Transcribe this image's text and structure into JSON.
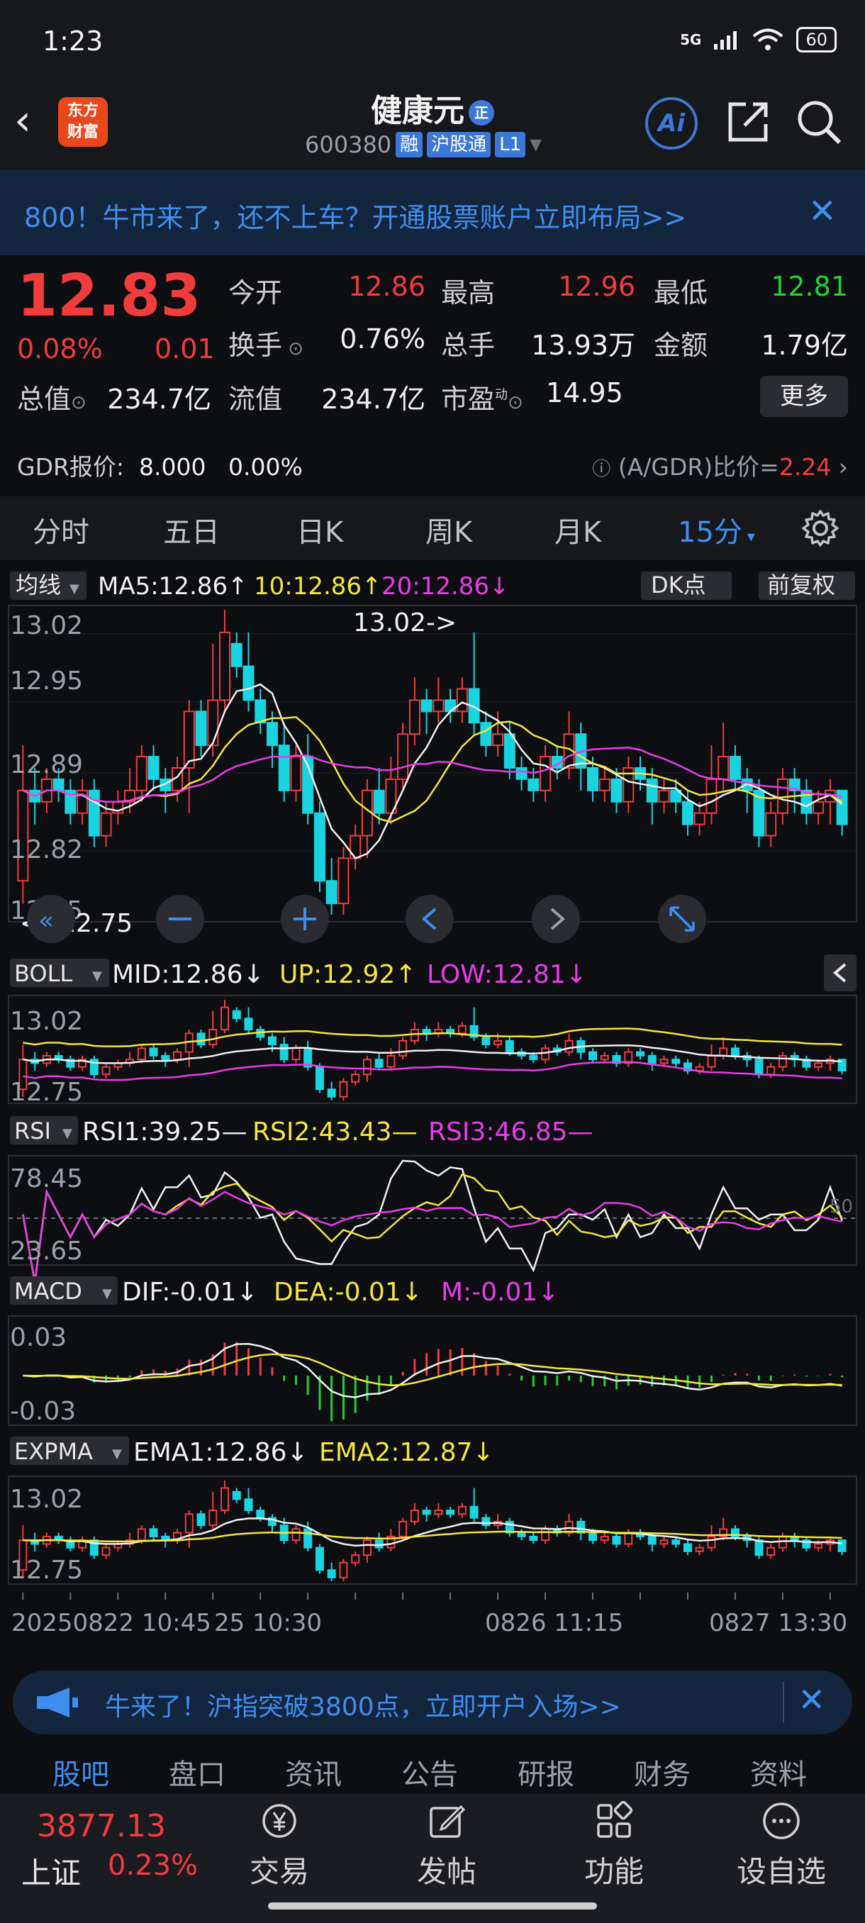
{
  "status_bar": {
    "time": "1:23",
    "network": "5G",
    "battery": "60"
  },
  "header": {
    "stock_name": "健康元",
    "badge": "正",
    "stock_code": "600380",
    "tags": [
      "融",
      "沪股通",
      "L1"
    ],
    "broker_logo": "东方\n财富",
    "ai_label": "Ai"
  },
  "top_banner": {
    "text": "800！牛市来了，还不上车？开通股票账户立即布局>>"
  },
  "quote": {
    "price": "12.83",
    "change_pct": "0.08%",
    "change_val": "0.01",
    "open_label": "今开",
    "open": "12.86",
    "high_label": "最高",
    "high": "12.96",
    "low_label": "最低",
    "low": "12.81",
    "turnover_label": "换手",
    "turnover": "0.76%",
    "volume_label": "总手",
    "volume": "13.93万",
    "amount_label": "金额",
    "amount": "1.79亿",
    "mktcap_label": "总值",
    "mktcap": "234.7亿",
    "float_label": "流值",
    "float": "234.7亿",
    "pe_label": "市盈",
    "pe_sup": "动",
    "pe": "14.95",
    "more_label": "更多",
    "gdr_label": "GDR报价:",
    "gdr_price": "8.000",
    "gdr_pct": "0.00%",
    "gdr_ratio_label": "(A/GDR)比价=",
    "gdr_ratio": "2.24"
  },
  "period_tabs": [
    "分时",
    "五日",
    "日K",
    "周K",
    "月K",
    "15分"
  ],
  "active_period": "15分",
  "chart_data": {
    "type": "candlestick",
    "main": {
      "indicator": "均线",
      "ma5": "MA5:12.86↑",
      "ma10": "10:12.86↑",
      "ma20": "20:12.86↓",
      "dk_label": "DK点",
      "adjust_label": "前复权",
      "ymax_label": "13.02",
      "y2_label": "12.95",
      "y3_label": "12.89",
      "y4_label": "12.82",
      "ymin_label": "12.75",
      "high_marker": "13.02->",
      "low_marker": "<--12.75",
      "ylim": [
        12.75,
        13.02
      ],
      "candles": [
        [
          12.78,
          12.86,
          12.9,
          12.76
        ],
        [
          12.86,
          12.85,
          12.88,
          12.83
        ],
        [
          12.85,
          12.87,
          12.88,
          12.84
        ],
        [
          12.87,
          12.86,
          12.88,
          12.85
        ],
        [
          12.86,
          12.84,
          12.87,
          12.83
        ],
        [
          12.84,
          12.86,
          12.87,
          12.83
        ],
        [
          12.86,
          12.82,
          12.87,
          12.81
        ],
        [
          12.82,
          12.84,
          12.85,
          12.81
        ],
        [
          12.84,
          12.85,
          12.86,
          12.83
        ],
        [
          12.85,
          12.86,
          12.88,
          12.84
        ],
        [
          12.86,
          12.89,
          12.9,
          12.85
        ],
        [
          12.89,
          12.87,
          12.9,
          12.86
        ],
        [
          12.87,
          12.86,
          12.88,
          12.84
        ],
        [
          12.86,
          12.88,
          12.89,
          12.85
        ],
        [
          12.88,
          12.93,
          12.94,
          12.84
        ],
        [
          12.93,
          12.9,
          12.94,
          12.89
        ],
        [
          12.9,
          12.94,
          12.99,
          12.89
        ],
        [
          12.94,
          13.0,
          13.02,
          12.93
        ],
        [
          12.99,
          12.97,
          13.0,
          12.96
        ],
        [
          12.97,
          12.94,
          13.0,
          12.93
        ],
        [
          12.94,
          12.92,
          12.95,
          12.91
        ],
        [
          12.92,
          12.9,
          12.93,
          12.88
        ],
        [
          12.9,
          12.86,
          12.92,
          12.85
        ],
        [
          12.86,
          12.89,
          12.9,
          12.85
        ],
        [
          12.89,
          12.84,
          12.91,
          12.83
        ],
        [
          12.84,
          12.78,
          12.85,
          12.77
        ],
        [
          12.78,
          12.76,
          12.8,
          12.75
        ],
        [
          12.76,
          12.8,
          12.81,
          12.75
        ],
        [
          12.8,
          12.82,
          12.83,
          12.79
        ],
        [
          12.82,
          12.86,
          12.87,
          12.8
        ],
        [
          12.86,
          12.84,
          12.88,
          12.83
        ],
        [
          12.84,
          12.87,
          12.89,
          12.83
        ],
        [
          12.87,
          12.91,
          12.92,
          12.86
        ],
        [
          12.91,
          12.94,
          12.96,
          12.9
        ],
        [
          12.94,
          12.93,
          12.95,
          12.91
        ],
        [
          12.93,
          12.94,
          12.96,
          12.92
        ],
        [
          12.94,
          12.93,
          12.95,
          12.92
        ],
        [
          12.93,
          12.95,
          12.96,
          12.92
        ],
        [
          12.95,
          12.92,
          13.0,
          12.91
        ],
        [
          12.92,
          12.9,
          12.93,
          12.89
        ],
        [
          12.9,
          12.91,
          12.93,
          12.89
        ],
        [
          12.91,
          12.88,
          12.92,
          12.87
        ],
        [
          12.88,
          12.87,
          12.89,
          12.86
        ],
        [
          12.87,
          12.86,
          12.88,
          12.85
        ],
        [
          12.86,
          12.89,
          12.9,
          12.85
        ],
        [
          12.89,
          12.88,
          12.9,
          12.87
        ],
        [
          12.88,
          12.91,
          12.93,
          12.87
        ],
        [
          12.91,
          12.88,
          12.92,
          12.86
        ],
        [
          12.88,
          12.86,
          12.89,
          12.85
        ],
        [
          12.86,
          12.87,
          12.88,
          12.85
        ],
        [
          12.87,
          12.85,
          12.88,
          12.84
        ],
        [
          12.85,
          12.88,
          12.89,
          12.84
        ],
        [
          12.88,
          12.87,
          12.89,
          12.86
        ],
        [
          12.87,
          12.85,
          12.88,
          12.83
        ],
        [
          12.85,
          12.86,
          12.87,
          12.84
        ],
        [
          12.86,
          12.85,
          12.87,
          12.84
        ],
        [
          12.85,
          12.83,
          12.86,
          12.82
        ],
        [
          12.83,
          12.84,
          12.85,
          12.82
        ],
        [
          12.84,
          12.87,
          12.9,
          12.83
        ],
        [
          12.87,
          12.89,
          12.92,
          12.86
        ],
        [
          12.89,
          12.87,
          12.9,
          12.86
        ],
        [
          12.87,
          12.86,
          12.88,
          12.84
        ],
        [
          12.86,
          12.82,
          12.87,
          12.81
        ],
        [
          12.82,
          12.84,
          12.85,
          12.81
        ],
        [
          12.84,
          12.87,
          12.88,
          12.83
        ],
        [
          12.87,
          12.86,
          12.88,
          12.84
        ],
        [
          12.86,
          12.84,
          12.87,
          12.83
        ],
        [
          12.84,
          12.85,
          12.86,
          12.83
        ],
        [
          12.85,
          12.86,
          12.87,
          12.83
        ],
        [
          12.86,
          12.83,
          12.86,
          12.82
        ]
      ]
    },
    "boll": {
      "label": "BOLL",
      "mid": "MID:12.86↓",
      "up": "UP:12.92↑",
      "low": "LOW:12.81↓",
      "ymax_label": "13.02",
      "ymin_label": "12.75"
    },
    "rsi": {
      "label": "RSI",
      "rsi1": "RSI1:39.25—",
      "rsi2": "RSI2:43.43—",
      "rsi3": "RSI3:46.85—",
      "ymax_label": "78.45",
      "ymin_label": "23.65",
      "mid_label": "50"
    },
    "macd": {
      "label": "MACD",
      "dif": "DIF:-0.01↓",
      "dea": "DEA:-0.01↓",
      "m": "M:-0.01↓",
      "ymax_label": "0.03",
      "ymin_label": "-0.03"
    },
    "expma": {
      "label": "EXPMA",
      "ema1": "EMA1:12.86↓",
      "ema2": "EMA2:12.87↓",
      "ymax_label": "13.02",
      "ymin_label": "12.75"
    },
    "x_labels": [
      "20250822 10:45",
      "25 10:30",
      "0826 11:15",
      "0827 13:30"
    ]
  },
  "bottom_banner": {
    "text": "牛来了！沪指突破3800点，立即开户入场>>"
  },
  "content_tabs": [
    "股吧",
    "盘口",
    "资讯",
    "公告",
    "研报",
    "财务",
    "资料"
  ],
  "bottom_nav": {
    "index_value": "3877.13",
    "index_name": "上证",
    "index_pct": "0.23%",
    "items": [
      "交易",
      "发帖",
      "功能",
      "设自选"
    ]
  }
}
